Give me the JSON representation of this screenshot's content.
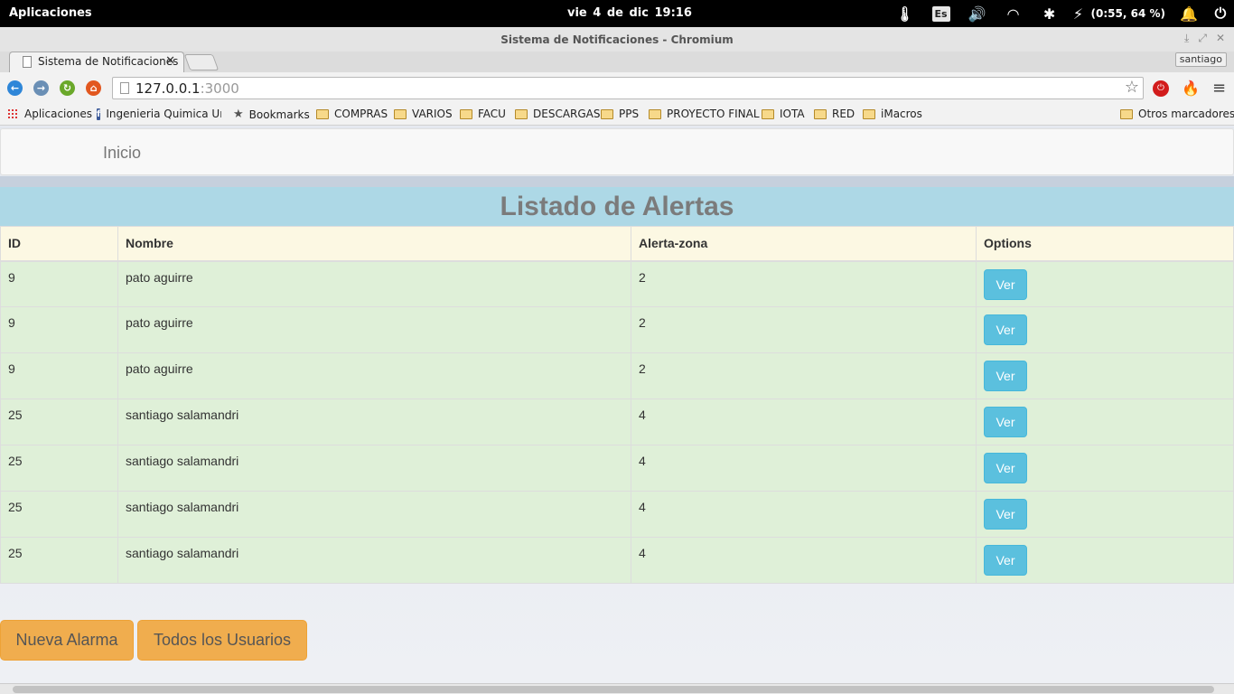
{
  "system_bar": {
    "apps_label": "Aplicaciones",
    "clock": "vie  4 de dic    19:16",
    "keyboard_layout": "Es",
    "battery": "(0:55, 64 %)"
  },
  "window": {
    "title": "Sistema de Notificaciones - Chromium",
    "tab_title": "Sistema de Notificaciones",
    "profile": "santiago"
  },
  "address_bar": {
    "host": "127.0.0.1",
    "port": ":3000"
  },
  "bookmarks_bar": {
    "items": [
      {
        "label": "Aplicaciones",
        "icon": "apps-grid-icon"
      },
      {
        "label": "Ingenieria Quimica Ur",
        "icon": "facebook-icon"
      },
      {
        "label": "Bookmarks",
        "icon": "star-icon"
      },
      {
        "label": "COMPRAS",
        "icon": "folder-icon"
      },
      {
        "label": "VARIOS",
        "icon": "folder-icon"
      },
      {
        "label": "FACU",
        "icon": "folder-icon"
      },
      {
        "label": "DESCARGAS",
        "icon": "folder-icon"
      },
      {
        "label": "PPS",
        "icon": "folder-icon"
      },
      {
        "label": "PROYECTO FINAL",
        "icon": "folder-icon"
      },
      {
        "label": "IOTA",
        "icon": "folder-icon"
      },
      {
        "label": "RED",
        "icon": "folder-icon"
      },
      {
        "label": "iMacros",
        "icon": "folder-icon"
      }
    ],
    "other": "Otros marcadores"
  },
  "page": {
    "nav_brand": "Inicio",
    "heading": "Listado de Alertas",
    "table": {
      "headers": [
        "ID",
        "Nombre",
        "Alerta-zona",
        "Options"
      ],
      "rows": [
        {
          "id": "9",
          "nombre": "pato aguirre",
          "zona": "2",
          "action": "Ver"
        },
        {
          "id": "9",
          "nombre": "pato aguirre",
          "zona": "2",
          "action": "Ver"
        },
        {
          "id": "9",
          "nombre": "pato aguirre",
          "zona": "2",
          "action": "Ver"
        },
        {
          "id": "25",
          "nombre": "santiago salamandri",
          "zona": "4",
          "action": "Ver"
        },
        {
          "id": "25",
          "nombre": "santiago salamandri",
          "zona": "4",
          "action": "Ver"
        },
        {
          "id": "25",
          "nombre": "santiago salamandri",
          "zona": "4",
          "action": "Ver"
        },
        {
          "id": "25",
          "nombre": "santiago salamandri",
          "zona": "4",
          "action": "Ver"
        }
      ]
    },
    "buttons": {
      "new_alarm": "Nueva Alarma",
      "all_users": "Todos los Usuarios"
    }
  },
  "colors": {
    "heading_bg": "#add8e6",
    "row_bg": "#dff0d8",
    "header_bg": "#fcf8e3",
    "info_button": "#5bc0de",
    "warning_button": "#f0ad4e"
  }
}
